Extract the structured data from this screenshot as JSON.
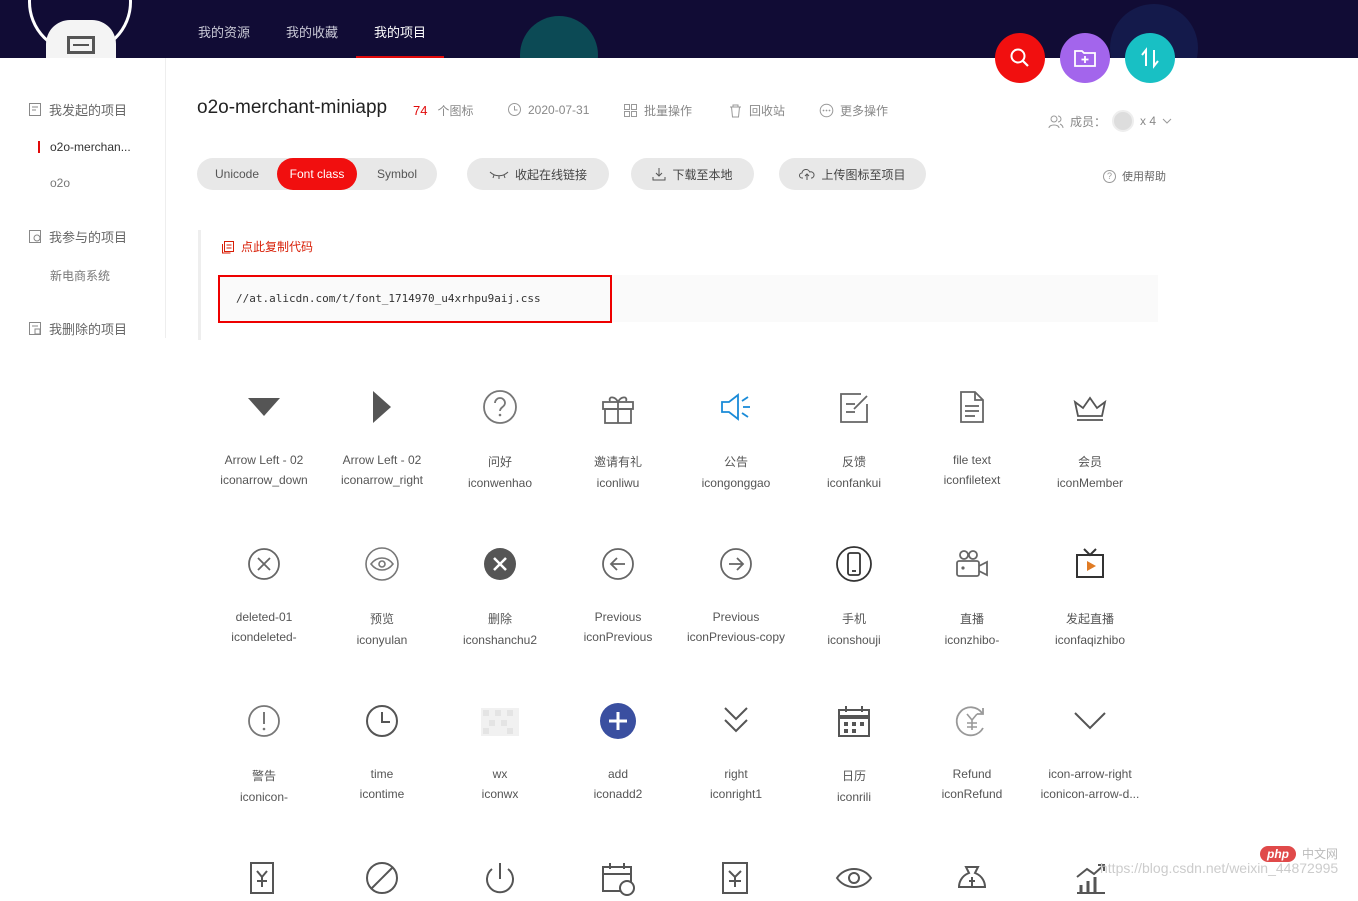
{
  "nav": {
    "items": [
      "我的资源",
      "我的收藏",
      "我的项目"
    ],
    "active_index": 2
  },
  "sidebar": {
    "sections": [
      {
        "title": "我发起的项目",
        "items": [
          "o2o-merchan...",
          "o2o"
        ]
      },
      {
        "title": "我参与的项目",
        "items": [
          "新电商系统"
        ]
      },
      {
        "title": "我删除的项目",
        "items": []
      }
    ]
  },
  "project": {
    "title": "o2o-merchant-miniapp",
    "icon_count": "74",
    "icon_count_label": "个图标",
    "date": "2020-07-31",
    "batch": "批量操作",
    "recycle": "回收站",
    "more": "更多操作",
    "members_label": "成员：",
    "members_count": "x 4"
  },
  "toolbar": {
    "tabs": [
      "Unicode",
      "Font class",
      "Symbol"
    ],
    "active_tab": 1,
    "collapse_link": "收起在线链接",
    "download": "下载至本地",
    "upload": "上传图标至项目",
    "help": "使用帮助"
  },
  "code": {
    "copy_label": "点此复制代码",
    "url": "//at.alicdn.com/t/font_1714970_u4xrhpu9aij.css"
  },
  "icons": [
    {
      "name": "Arrow Left - 02",
      "class": "iconarrow_down",
      "glyph": "triangle-down-icon"
    },
    {
      "name": "Arrow Left - 02",
      "class": "iconarrow_right",
      "glyph": "triangle-right-icon"
    },
    {
      "name": "问好",
      "class": "iconwenhao",
      "glyph": "question-icon"
    },
    {
      "name": "邀请有礼",
      "class": "iconliwu",
      "glyph": "gift-icon"
    },
    {
      "name": "公告",
      "class": "icongonggao",
      "glyph": "speaker-icon"
    },
    {
      "name": "反馈",
      "class": "iconfankui",
      "glyph": "feedback-icon"
    },
    {
      "name": "file text",
      "class": "iconfiletext",
      "glyph": "file-text-icon"
    },
    {
      "name": "会员",
      "class": "iconMember",
      "glyph": "crown-icon"
    },
    {
      "name": "deleted-01",
      "class": "icondeleted-",
      "glyph": "circle-x-icon"
    },
    {
      "name": "预览",
      "class": "iconyulan",
      "glyph": "eye-circle-icon"
    },
    {
      "name": "删除",
      "class": "iconshanchu2",
      "glyph": "delete-filled-icon"
    },
    {
      "name": "Previous",
      "class": "iconPrevious",
      "glyph": "arrow-left-circle-icon"
    },
    {
      "name": "Previous",
      "class": "iconPrevious-copy",
      "glyph": "arrow-right-circle-icon"
    },
    {
      "name": "手机",
      "class": "iconshouji",
      "glyph": "phone-icon"
    },
    {
      "name": "直播",
      "class": "iconzhibo-",
      "glyph": "camera-icon"
    },
    {
      "name": "发起直播",
      "class": "iconfaqizhibo",
      "glyph": "tv-icon"
    },
    {
      "name": "警告",
      "class": "iconicon-",
      "glyph": "warning-icon"
    },
    {
      "name": "time",
      "class": "icontime",
      "glyph": "clock-icon"
    },
    {
      "name": "wx",
      "class": "iconwx",
      "glyph": "wx-icon"
    },
    {
      "name": "add",
      "class": "iconadd2",
      "glyph": "add-icon"
    },
    {
      "name": "right",
      "class": "iconright1",
      "glyph": "double-chevron-down-icon"
    },
    {
      "name": "日历",
      "class": "iconrili",
      "glyph": "calendar-icon"
    },
    {
      "name": "Refund",
      "class": "iconRefund",
      "glyph": "refund-icon"
    },
    {
      "name": "icon-arrow-right",
      "class": "iconicon-arrow-d...",
      "glyph": "chevron-down-icon"
    },
    {
      "name": "",
      "class": "",
      "glyph": "yen-edit-icon"
    },
    {
      "name": "",
      "class": "",
      "glyph": "ban-icon"
    },
    {
      "name": "",
      "class": "",
      "glyph": "power-icon"
    },
    {
      "name": "",
      "class": "",
      "glyph": "calendar-clock-icon"
    },
    {
      "name": "",
      "class": "",
      "glyph": "yen-doc-icon"
    },
    {
      "name": "",
      "class": "",
      "glyph": "eye-icon"
    },
    {
      "name": "",
      "class": "",
      "glyph": "money-bag-icon"
    },
    {
      "name": "",
      "class": "",
      "glyph": "chart-up-icon"
    }
  ],
  "watermark": {
    "badge": "php",
    "text": "中文网",
    "url": "https://blog.csdn.net/weixin_44872995"
  },
  "colors": {
    "brand_red": "#f10f0f",
    "topbar": "#110c35",
    "purple": "#a365ec",
    "teal": "#18c0c4",
    "blue_icon": "#1a8bd8",
    "add_blue": "#3a4fa0"
  }
}
